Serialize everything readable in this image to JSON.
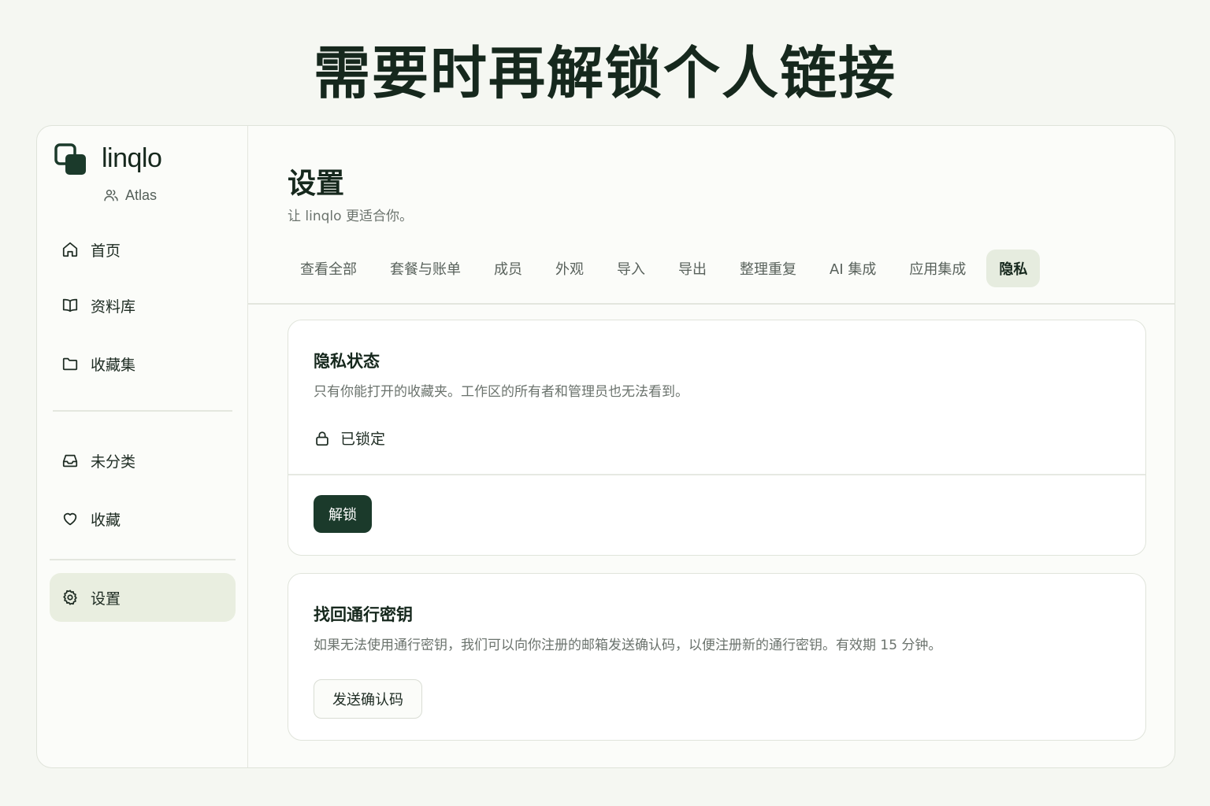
{
  "headline": "需要时再解锁个人链接",
  "sidebar": {
    "brand": "linqlo",
    "workspace": "Atlas",
    "items": [
      {
        "label": "首页",
        "icon": "home-icon"
      },
      {
        "label": "资料库",
        "icon": "book-icon"
      },
      {
        "label": "收藏集",
        "icon": "folder-icon"
      },
      {
        "label": "未分类",
        "icon": "inbox-icon"
      },
      {
        "label": "收藏",
        "icon": "heart-icon"
      },
      {
        "label": "设置",
        "icon": "gear-icon",
        "active": true
      }
    ]
  },
  "main": {
    "title": "设置",
    "subtitle": "让 linqlo 更适合你。",
    "tabs": [
      {
        "label": "查看全部"
      },
      {
        "label": "套餐与账单"
      },
      {
        "label": "成员"
      },
      {
        "label": "外观"
      },
      {
        "label": "导入"
      },
      {
        "label": "导出"
      },
      {
        "label": "整理重复"
      },
      {
        "label": "AI 集成"
      },
      {
        "label": "应用集成"
      },
      {
        "label": "隐私",
        "active": true
      }
    ],
    "privacy_card": {
      "title": "隐私状态",
      "description": "只有你能打开的收藏夹。工作区的所有者和管理员也无法看到。",
      "status_label": "已锁定",
      "unlock_label": "解锁"
    },
    "recovery_card": {
      "title": "找回通行密钥",
      "description": "如果无法使用通行密钥，我们可以向你注册的邮箱发送确认码，以便注册新的通行密钥。有效期 15 分钟。",
      "send_label": "发送确认码"
    }
  },
  "colors": {
    "accent": "#1b3a2b",
    "active_bg": "#e9eee0",
    "background": "#f5f7f2"
  }
}
